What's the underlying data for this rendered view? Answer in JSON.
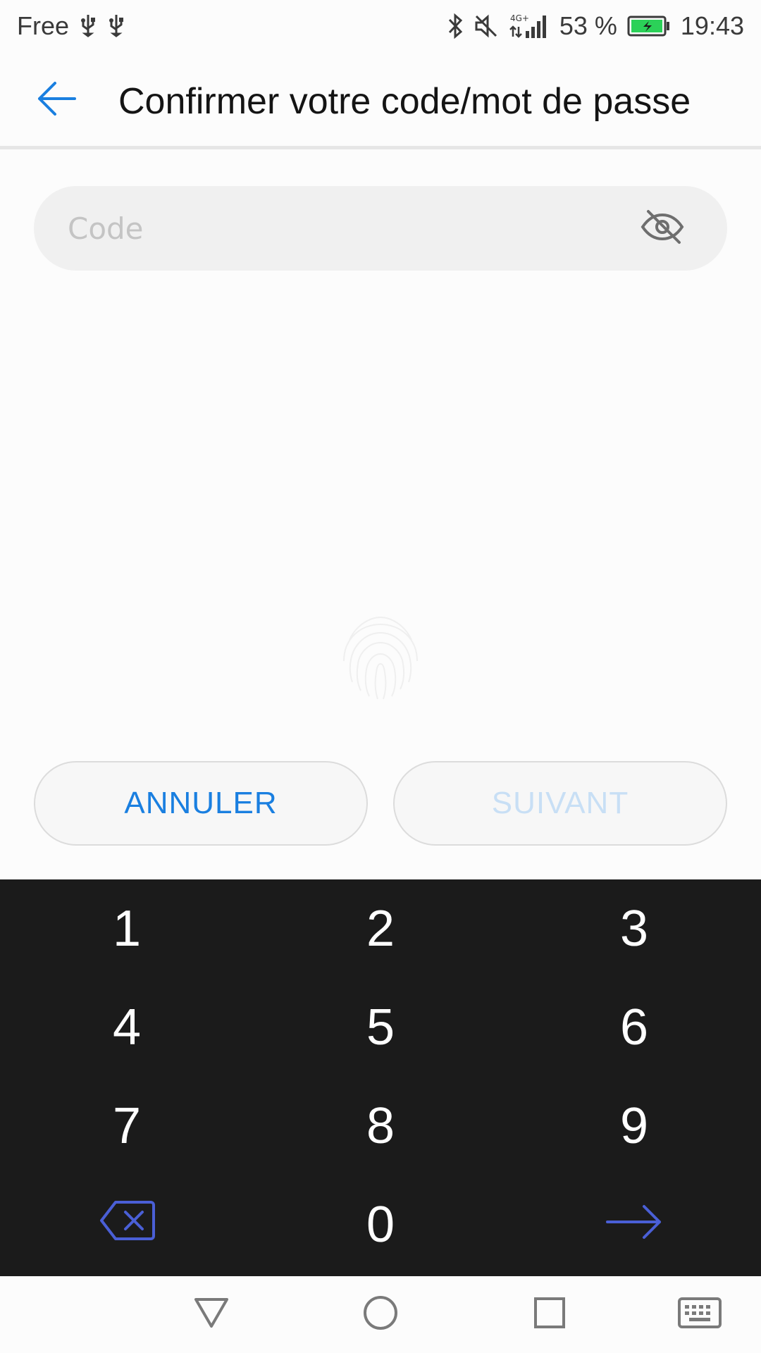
{
  "status_bar": {
    "carrier": "Free",
    "battery_percent": "53 %",
    "time": "19:43",
    "network": "4G+",
    "icons": [
      "usb-icon",
      "usb-icon",
      "bluetooth-icon",
      "mute-icon",
      "signal-icon",
      "battery-charging-icon"
    ]
  },
  "header": {
    "title": "Confirmer votre code/mot de passe",
    "back_icon": "back-arrow-icon"
  },
  "code_field": {
    "placeholder": "Code",
    "value": "",
    "visibility_icon": "eye-off-icon"
  },
  "actions": {
    "cancel_label": "ANNULER",
    "next_label": "SUIVANT"
  },
  "keypad": {
    "keys": [
      "1",
      "2",
      "3",
      "4",
      "5",
      "6",
      "7",
      "8",
      "9",
      "0"
    ],
    "delete_icon": "backspace-icon",
    "enter_icon": "enter-arrow-icon"
  },
  "nav_bar": {
    "icons": [
      "back-triangle-icon",
      "home-circle-icon",
      "recents-square-icon",
      "keyboard-icon"
    ]
  },
  "colors": {
    "accent": "#1a7fe0",
    "disabled_text": "#c8dff5",
    "keypad_bg": "#1b1b1b",
    "keypad_accent": "#4a5fd6"
  }
}
